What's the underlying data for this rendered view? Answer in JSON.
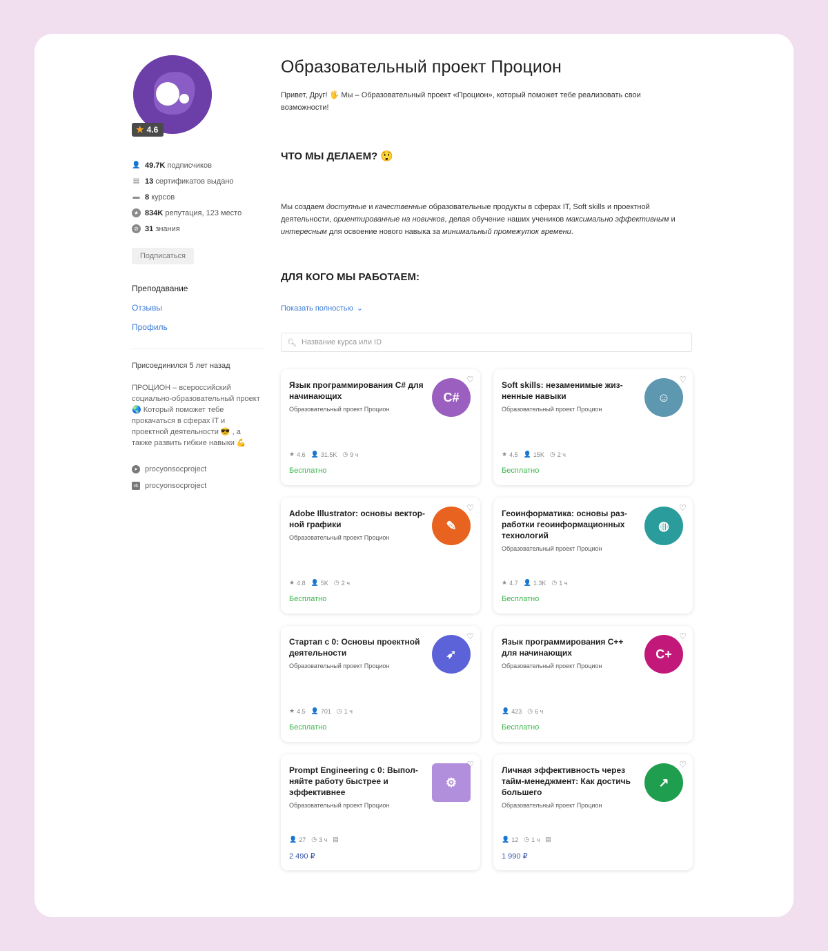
{
  "profile": {
    "rating": "4.6",
    "stats": [
      {
        "icon": "user-icon",
        "value": "49.7K",
        "label": "подписчиков"
      },
      {
        "icon": "certificate-icon",
        "value": "13",
        "label": "сертификатов выдано"
      },
      {
        "icon": "briefcase-icon",
        "value": "8",
        "label": "курсов"
      },
      {
        "icon": "star-badge-icon",
        "value": "834K",
        "label": "репутация, 123 место"
      },
      {
        "icon": "knowledge-icon",
        "value": "31",
        "label": "знания"
      }
    ],
    "subscribe_label": "Подписаться",
    "nav": [
      {
        "label": "Преподавание",
        "active": true
      },
      {
        "label": "Отзывы",
        "active": false
      },
      {
        "label": "Профиль",
        "active": false
      }
    ],
    "joined": "Присоединился 5 лет назад",
    "about": "ПРОЦИОН – всероссийский социально-образовательный проект 🌏 Который поможет тебе прокачаться в сферах IT и проектной деятельности 😎 , а также развить гибкие навыки 💪",
    "social": [
      {
        "icon": "telegram-icon",
        "label": "procyonsocproject"
      },
      {
        "icon": "vk-icon",
        "label": "procyonsocproject"
      }
    ]
  },
  "main": {
    "title": "Образовательный проект Процион",
    "intro": "Привет, Друг! 🖐 Мы – Образовательный проект «Процион», который поможет тебе реализовать свои возможности!",
    "what_heading": "ЧТО МЫ ДЕЛАЕМ? 😲",
    "desc_parts": {
      "p1": "Мы создаем ",
      "i1": "доступные",
      "p2": " и ",
      "i2": "качественные",
      "p3": " образовательные продукты в сферах IT, Soft skills и проектной деятельности, ",
      "i3": "ориентированные на новичков",
      "p4": ", делая обучение наших учеников ",
      "i4": "максимально эффективным",
      "p5": " и ",
      "i5": "интересным",
      "p6": " для освоение нового навыка за  ",
      "i6": "минимальный промежуток времени",
      "p7": "."
    },
    "for_whom_heading": "ДЛЯ КОГО МЫ РАБОТАЕМ:",
    "show_more": "Показать полностью",
    "search_placeholder": "Название курса или ID"
  },
  "courses": [
    {
      "title": "Язык программирования C# для начинающих",
      "author": "Образовательный проект Процион",
      "logo_color": "#9b5fc0",
      "logo_text": "C#",
      "rating": "4.6",
      "learners": "31.5K",
      "hours": "9 ч",
      "price": "Бесплатно",
      "free": true
    },
    {
      "title": "Soft skills: незаменимые жиз-ненные навыки",
      "author": "Образовательный проект Процион",
      "logo_color": "#5e97b0",
      "logo_text": "☺",
      "rating": "4.5",
      "learners": "15K",
      "hours": "2 ч",
      "price": "Бесплатно",
      "free": true
    },
    {
      "title": "Adobe Illustrator: основы вектор-ной графики",
      "author": "Образовательный проект Процион",
      "logo_color": "#e8631f",
      "logo_text": "✎",
      "rating": "4.8",
      "learners": "5K",
      "hours": "2 ч",
      "price": "Бесплатно",
      "free": true
    },
    {
      "title": "Геоинформатика: основы раз-работки геоинформационных технологий",
      "author": "Образовательный проект Процион",
      "logo_color": "#2a9c9c",
      "logo_text": "◍",
      "rating": "4.7",
      "learners": "1.3K",
      "hours": "1 ч",
      "price": "Бесплатно",
      "free": true
    },
    {
      "title": "Стартап с 0: Основы проектной деятельности",
      "author": "Образовательный проект Процион",
      "logo_color": "#5c63d8",
      "logo_text": "➶",
      "rating": "4.5",
      "learners": "701",
      "hours": "1 ч",
      "price": "Бесплатно",
      "free": true
    },
    {
      "title": "Язык программирования C++ для начинающих",
      "author": "Образовательный проект Процион",
      "logo_color": "#c2187a",
      "logo_text": "C+",
      "rating": "",
      "learners": "423",
      "hours": "6 ч",
      "price": "Бесплатно",
      "free": true
    },
    {
      "title": "Prompt Engineering с 0: Выпол-няйте работу быстрее и эффективнее",
      "author": "Образовательный проект Процион",
      "logo_color": "#b28fdc",
      "logo_text": "⚙",
      "rating": "",
      "learners": "27",
      "hours": "3 ч",
      "price": "2 490 ₽",
      "free": false
    },
    {
      "title": "Личная эффективность через тайм-менеджмент: Как достичь большего",
      "author": "Образовательный проект Процион",
      "logo_color": "#1f9e4f",
      "logo_text": "↗",
      "rating": "",
      "learners": "12",
      "hours": "1 ч",
      "price": "1 990 ₽",
      "free": false
    }
  ]
}
